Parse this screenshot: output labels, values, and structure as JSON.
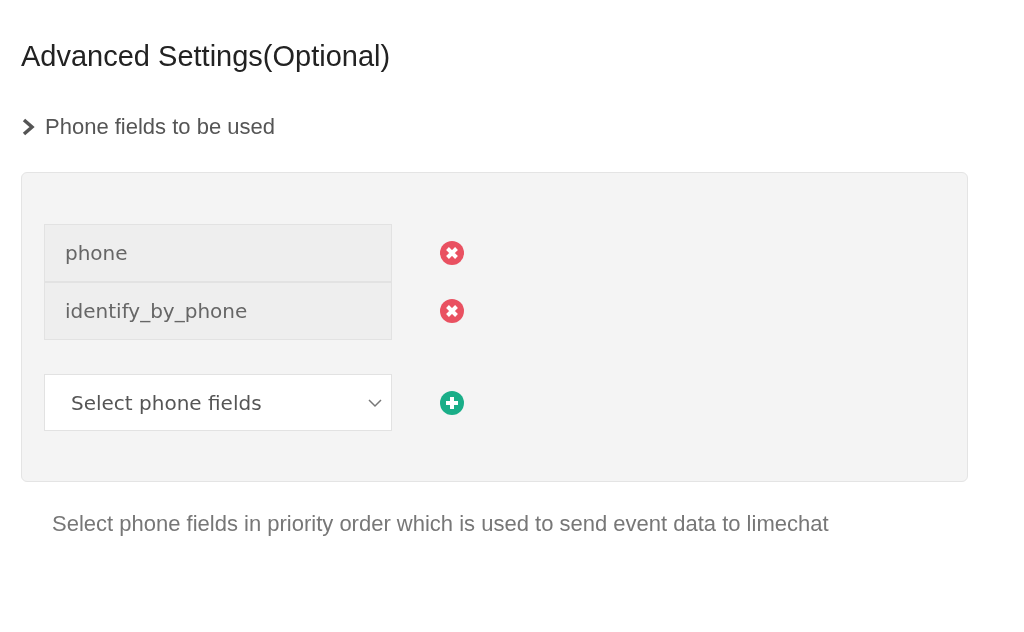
{
  "title": "Advanced Settings(Optional)",
  "section": {
    "label": "Phone fields to be used",
    "expanded": false
  },
  "fields": [
    {
      "value": "phone"
    },
    {
      "value": "identify_by_phone"
    }
  ],
  "select": {
    "placeholder": "Select phone fields"
  },
  "help": "Select phone fields in priority order which is used to send event data to limechat"
}
